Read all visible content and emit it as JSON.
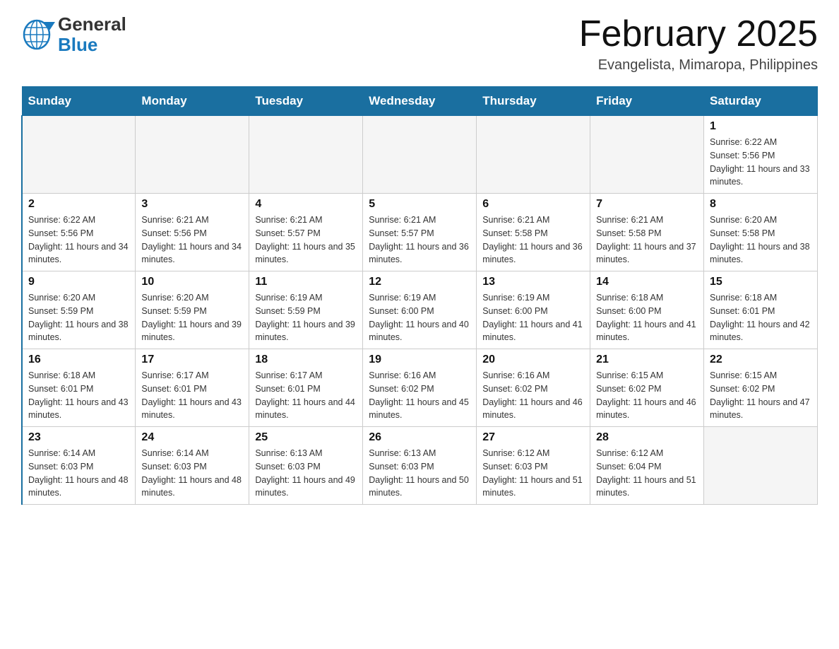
{
  "header": {
    "logo": {
      "general": "General",
      "blue": "Blue",
      "alt": "GeneralBlue logo"
    },
    "title": "February 2025",
    "location": "Evangelista, Mimaropa, Philippines"
  },
  "calendar": {
    "days_of_week": [
      "Sunday",
      "Monday",
      "Tuesday",
      "Wednesday",
      "Thursday",
      "Friday",
      "Saturday"
    ],
    "weeks": [
      {
        "days": [
          {
            "number": "",
            "sunrise": "",
            "sunset": "",
            "daylight": "",
            "empty": true
          },
          {
            "number": "",
            "sunrise": "",
            "sunset": "",
            "daylight": "",
            "empty": true
          },
          {
            "number": "",
            "sunrise": "",
            "sunset": "",
            "daylight": "",
            "empty": true
          },
          {
            "number": "",
            "sunrise": "",
            "sunset": "",
            "daylight": "",
            "empty": true
          },
          {
            "number": "",
            "sunrise": "",
            "sunset": "",
            "daylight": "",
            "empty": true
          },
          {
            "number": "",
            "sunrise": "",
            "sunset": "",
            "daylight": "",
            "empty": true
          },
          {
            "number": "1",
            "sunrise": "Sunrise: 6:22 AM",
            "sunset": "Sunset: 5:56 PM",
            "daylight": "Daylight: 11 hours and 33 minutes.",
            "empty": false
          }
        ]
      },
      {
        "days": [
          {
            "number": "2",
            "sunrise": "Sunrise: 6:22 AM",
            "sunset": "Sunset: 5:56 PM",
            "daylight": "Daylight: 11 hours and 34 minutes.",
            "empty": false
          },
          {
            "number": "3",
            "sunrise": "Sunrise: 6:21 AM",
            "sunset": "Sunset: 5:56 PM",
            "daylight": "Daylight: 11 hours and 34 minutes.",
            "empty": false
          },
          {
            "number": "4",
            "sunrise": "Sunrise: 6:21 AM",
            "sunset": "Sunset: 5:57 PM",
            "daylight": "Daylight: 11 hours and 35 minutes.",
            "empty": false
          },
          {
            "number": "5",
            "sunrise": "Sunrise: 6:21 AM",
            "sunset": "Sunset: 5:57 PM",
            "daylight": "Daylight: 11 hours and 36 minutes.",
            "empty": false
          },
          {
            "number": "6",
            "sunrise": "Sunrise: 6:21 AM",
            "sunset": "Sunset: 5:58 PM",
            "daylight": "Daylight: 11 hours and 36 minutes.",
            "empty": false
          },
          {
            "number": "7",
            "sunrise": "Sunrise: 6:21 AM",
            "sunset": "Sunset: 5:58 PM",
            "daylight": "Daylight: 11 hours and 37 minutes.",
            "empty": false
          },
          {
            "number": "8",
            "sunrise": "Sunrise: 6:20 AM",
            "sunset": "Sunset: 5:58 PM",
            "daylight": "Daylight: 11 hours and 38 minutes.",
            "empty": false
          }
        ]
      },
      {
        "days": [
          {
            "number": "9",
            "sunrise": "Sunrise: 6:20 AM",
            "sunset": "Sunset: 5:59 PM",
            "daylight": "Daylight: 11 hours and 38 minutes.",
            "empty": false
          },
          {
            "number": "10",
            "sunrise": "Sunrise: 6:20 AM",
            "sunset": "Sunset: 5:59 PM",
            "daylight": "Daylight: 11 hours and 39 minutes.",
            "empty": false
          },
          {
            "number": "11",
            "sunrise": "Sunrise: 6:19 AM",
            "sunset": "Sunset: 5:59 PM",
            "daylight": "Daylight: 11 hours and 39 minutes.",
            "empty": false
          },
          {
            "number": "12",
            "sunrise": "Sunrise: 6:19 AM",
            "sunset": "Sunset: 6:00 PM",
            "daylight": "Daylight: 11 hours and 40 minutes.",
            "empty": false
          },
          {
            "number": "13",
            "sunrise": "Sunrise: 6:19 AM",
            "sunset": "Sunset: 6:00 PM",
            "daylight": "Daylight: 11 hours and 41 minutes.",
            "empty": false
          },
          {
            "number": "14",
            "sunrise": "Sunrise: 6:18 AM",
            "sunset": "Sunset: 6:00 PM",
            "daylight": "Daylight: 11 hours and 41 minutes.",
            "empty": false
          },
          {
            "number": "15",
            "sunrise": "Sunrise: 6:18 AM",
            "sunset": "Sunset: 6:01 PM",
            "daylight": "Daylight: 11 hours and 42 minutes.",
            "empty": false
          }
        ]
      },
      {
        "days": [
          {
            "number": "16",
            "sunrise": "Sunrise: 6:18 AM",
            "sunset": "Sunset: 6:01 PM",
            "daylight": "Daylight: 11 hours and 43 minutes.",
            "empty": false
          },
          {
            "number": "17",
            "sunrise": "Sunrise: 6:17 AM",
            "sunset": "Sunset: 6:01 PM",
            "daylight": "Daylight: 11 hours and 43 minutes.",
            "empty": false
          },
          {
            "number": "18",
            "sunrise": "Sunrise: 6:17 AM",
            "sunset": "Sunset: 6:01 PM",
            "daylight": "Daylight: 11 hours and 44 minutes.",
            "empty": false
          },
          {
            "number": "19",
            "sunrise": "Sunrise: 6:16 AM",
            "sunset": "Sunset: 6:02 PM",
            "daylight": "Daylight: 11 hours and 45 minutes.",
            "empty": false
          },
          {
            "number": "20",
            "sunrise": "Sunrise: 6:16 AM",
            "sunset": "Sunset: 6:02 PM",
            "daylight": "Daylight: 11 hours and 46 minutes.",
            "empty": false
          },
          {
            "number": "21",
            "sunrise": "Sunrise: 6:15 AM",
            "sunset": "Sunset: 6:02 PM",
            "daylight": "Daylight: 11 hours and 46 minutes.",
            "empty": false
          },
          {
            "number": "22",
            "sunrise": "Sunrise: 6:15 AM",
            "sunset": "Sunset: 6:02 PM",
            "daylight": "Daylight: 11 hours and 47 minutes.",
            "empty": false
          }
        ]
      },
      {
        "days": [
          {
            "number": "23",
            "sunrise": "Sunrise: 6:14 AM",
            "sunset": "Sunset: 6:03 PM",
            "daylight": "Daylight: 11 hours and 48 minutes.",
            "empty": false
          },
          {
            "number": "24",
            "sunrise": "Sunrise: 6:14 AM",
            "sunset": "Sunset: 6:03 PM",
            "daylight": "Daylight: 11 hours and 48 minutes.",
            "empty": false
          },
          {
            "number": "25",
            "sunrise": "Sunrise: 6:13 AM",
            "sunset": "Sunset: 6:03 PM",
            "daylight": "Daylight: 11 hours and 49 minutes.",
            "empty": false
          },
          {
            "number": "26",
            "sunrise": "Sunrise: 6:13 AM",
            "sunset": "Sunset: 6:03 PM",
            "daylight": "Daylight: 11 hours and 50 minutes.",
            "empty": false
          },
          {
            "number": "27",
            "sunrise": "Sunrise: 6:12 AM",
            "sunset": "Sunset: 6:03 PM",
            "daylight": "Daylight: 11 hours and 51 minutes.",
            "empty": false
          },
          {
            "number": "28",
            "sunrise": "Sunrise: 6:12 AM",
            "sunset": "Sunset: 6:04 PM",
            "daylight": "Daylight: 11 hours and 51 minutes.",
            "empty": false
          },
          {
            "number": "",
            "sunrise": "",
            "sunset": "",
            "daylight": "",
            "empty": true
          }
        ]
      }
    ]
  }
}
